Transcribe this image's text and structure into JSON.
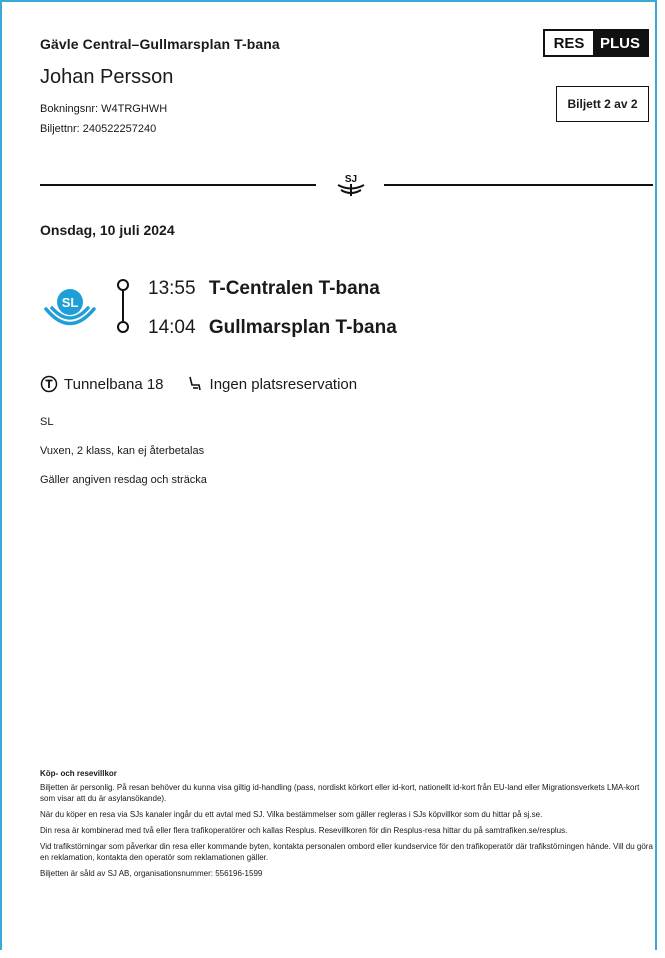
{
  "ticket": {
    "route": "Gävle Central–Gullmarsplan T-bana",
    "passenger": "Johan Persson",
    "booking": "Bokningsnr: W4TRGHWH",
    "ticket_nr": "Biljettnr: 240522257240",
    "brand": {
      "res": "RES",
      "plus": "PLUS"
    },
    "ticket_count": "Biljett 2 av 2",
    "sj_logo_text": "SJ"
  },
  "journey": {
    "date": "Onsdag, 10 juli 2024",
    "operator_logo_text": "SL",
    "departure": {
      "time": "13:55",
      "station": "T-Centralen T-bana"
    },
    "arrival": {
      "time": "14:04",
      "station": "Gullmarsplan T-bana"
    },
    "line": "Tunnelbana 18",
    "seat": "Ingen platsreservation",
    "operator": "SL",
    "fare": "Vuxen, 2 klass, kan ej återbetalas",
    "validity": "Gäller angiven resdag och sträcka"
  },
  "terms": {
    "heading": "Köp- och resevillkor",
    "paragraphs": [
      "Biljetten är personlig. På resan behöver du kunna visa giltig id-handling (pass, nordiskt körkort eller id-kort, nationellt id-kort från EU-land eller Migrationsverkets LMA-kort som visar att du är asylansökande).",
      "När du köper en resa via SJs kanaler ingår du ett avtal med SJ. Vilka bestämmelser som gäller regleras i SJs köpvillkor som du hittar på sj.se.",
      "Din resa är kombinerad med två eller flera trafikoperatörer och kallas Resplus. Resevillkoren för din Resplus-resa hittar du på samtrafiken.se/resplus.",
      "Vid trafikstörningar som påverkar din resa eller kommande byten, kontakta personalen ombord eller kundservice för den trafikoperatör där trafikstörningen hände. Vill du göra en reklamation, kontakta den operatör som reklamationen gäller.",
      "Biljetten är såld av SJ AB, organisationsnummer: 556196-1599"
    ]
  },
  "colors": {
    "border": "#3aa9d6",
    "sl_blue": "#1e9fd8",
    "text": "#1a1a1a"
  }
}
